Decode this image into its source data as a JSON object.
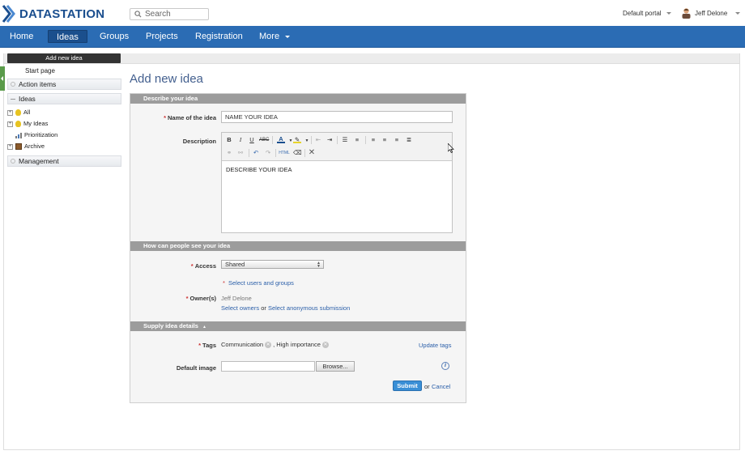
{
  "app": {
    "logo_text": "DATASTATION"
  },
  "search": {
    "placeholder": "Search"
  },
  "header": {
    "portal_label": "Default portal",
    "user_name": "Jeff Delone"
  },
  "nav": {
    "items": [
      "Home",
      "Ideas",
      "Groups",
      "Projects",
      "Registration",
      "More"
    ],
    "active": "Ideas"
  },
  "sidebar": {
    "add_button": "Add new idea",
    "start_page": "Start page",
    "action_items": "Action items",
    "ideas": "Ideas",
    "tree": [
      "All",
      "My Ideas",
      "Prioritization",
      "Archive"
    ],
    "management": "Management"
  },
  "page": {
    "title": "Add new idea"
  },
  "form": {
    "section_describe": "Describe your idea",
    "name_label": "Name of the idea",
    "name_value": "NAME YOUR IDEA",
    "description_label": "Description",
    "description_value": "DESCRIBE YOUR IDEA",
    "section_visibility": "How can people see your idea",
    "access_label": "Access",
    "access_value": "Shared",
    "select_users": "Select users and groups",
    "owners_label": "Owner(s)",
    "owner_name": "Jeff Delone",
    "select_owners": "Select owners",
    "or_text": "or",
    "select_anonymous": "Select anonymous submission",
    "section_details": "Supply idea details",
    "tags_label": "Tags",
    "tag1": "Communication",
    "tag2": ", High importance",
    "update_tags": "Update tags",
    "default_image_label": "Default image",
    "browse": "Browse...",
    "submit": "Submit",
    "cancel": "Cancel",
    "required_mark": "*"
  },
  "colors": {
    "nav_bg": "#2b6cb4",
    "nav_active": "#1b4f8d",
    "section_head": "#9c9c9c",
    "link": "#2b5fa9",
    "submit": "#3a8fd6"
  }
}
